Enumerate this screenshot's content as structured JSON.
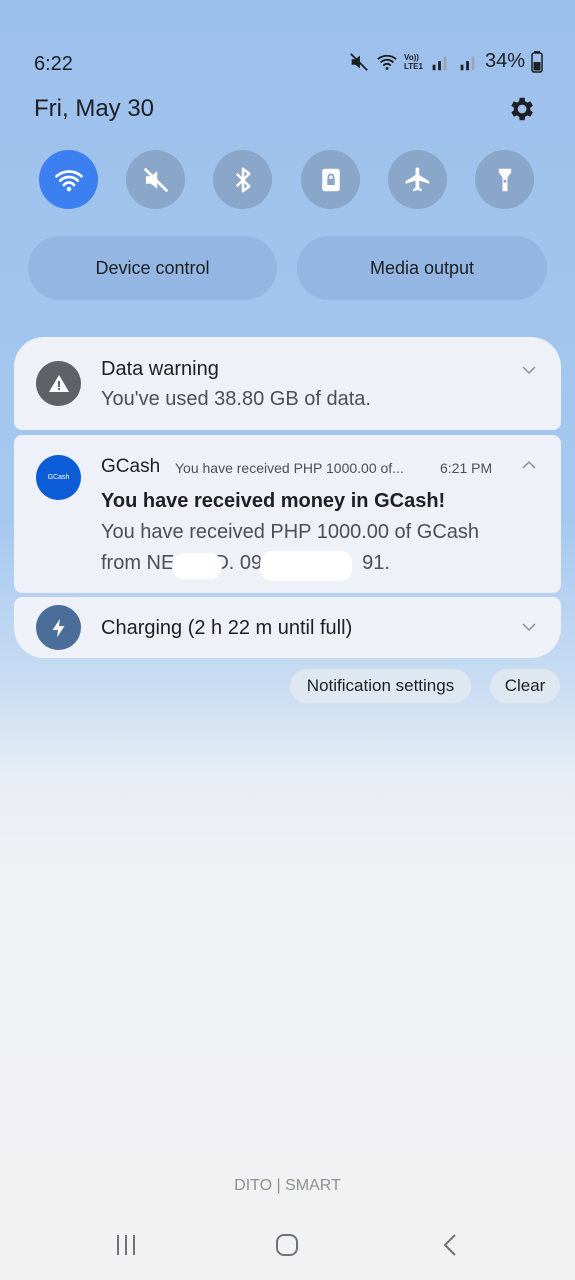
{
  "status": {
    "time": "6:22",
    "battery": "34%",
    "date": "Fri, May 30",
    "volte_top": "Vo))",
    "volte_bottom": "LTE1"
  },
  "quick_settings": {
    "toggles": [
      {
        "icon": "wifi-icon",
        "state": "on"
      },
      {
        "icon": "mute-icon",
        "state": "off"
      },
      {
        "icon": "bluetooth-icon",
        "state": "off"
      },
      {
        "icon": "rotation-lock-icon",
        "state": "off"
      },
      {
        "icon": "airplane-icon",
        "state": "off"
      },
      {
        "icon": "flashlight-icon",
        "state": "off"
      }
    ],
    "device_control": "Device control",
    "media_output": "Media output"
  },
  "notifications": {
    "data_warning": {
      "title": "Data warning",
      "body": "You've used 38.80 GB of data."
    },
    "gcash": {
      "app": "GCash",
      "logo_text": "GCash",
      "preview": "You have received PHP 1000.00 of...",
      "time": "6:21 PM",
      "title": "You have received money in GCash!",
      "body_line1": "You have received PHP 1000.00 of GCash",
      "body_line2": "from NE  D. 09     91."
    },
    "charging": {
      "title": "Charging (2 h 22 m until full)"
    }
  },
  "actions": {
    "notification_settings": "Notification settings",
    "clear": "Clear"
  },
  "carrier": "DITO | SMART",
  "colors": {
    "accent": "#3b7ff0",
    "gcash_blue": "#0b5cd6",
    "warning_gray": "#5f6167",
    "charging_blue": "#4b6d99"
  }
}
